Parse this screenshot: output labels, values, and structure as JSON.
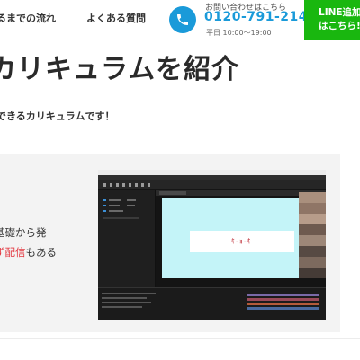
{
  "header": {
    "nav": [
      {
        "label": "るまでの流れ"
      },
      {
        "label": "よくある質問"
      }
    ],
    "contact": {
      "lead": "お問い合わせはこちら",
      "phone": "0120-791-214",
      "hours": "平日 10:00〜19:00",
      "icon": "phone-icon"
    },
    "line_button": {
      "line1": "LINE追加",
      "line2": "はこちら!"
    }
  },
  "main": {
    "title": "カリキュラムを紹介",
    "subtitle": "できるカリキュラムです！"
  },
  "card": {
    "line1": "基礎から発",
    "line2_highlight": "ず配信",
    "line2_rest": "もある",
    "app_screen": {
      "canvas_text": "ｷ‐ｮ‐ｷ"
    }
  },
  "colors": {
    "accent_blue": "#1a9ad9",
    "line_green": "#19b70f",
    "highlight_red": "#e3363f",
    "card_bg": "#f3f3f3",
    "canvas_cyan": "#c4f4f8"
  }
}
